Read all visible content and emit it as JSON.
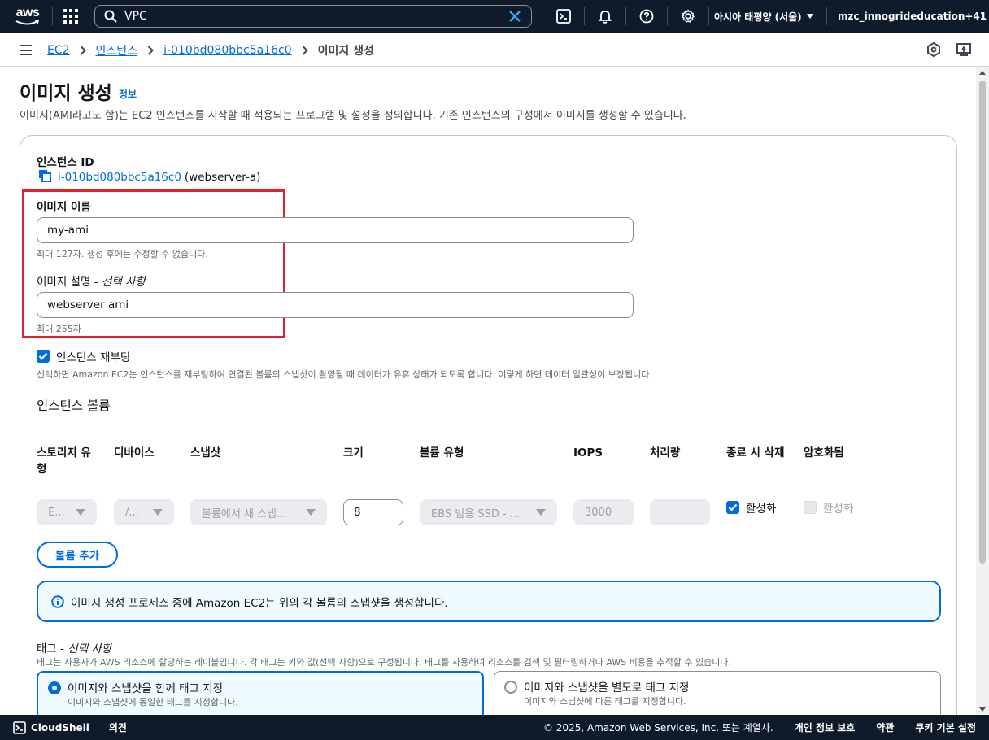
{
  "topnav": {
    "logo_text": "aws",
    "search_value": "VPC",
    "region": "아시아 태평양 (서울)",
    "account": "mzc_innogrideducation+41"
  },
  "breadcrumb": {
    "items": [
      "EC2",
      "인스턴스",
      "i-010bd080bbc5a16c0"
    ],
    "current": "이미지 생성"
  },
  "page": {
    "title": "이미지 생성",
    "info_link": "정보",
    "description": "이미지(AMI라고도 함)는 EC2 인스턴스를 시작할 때 적용되는 프로그램 및 설정을 정의합니다. 기존 인스턴스의 구성에서 이미지를 생성할 수 있습니다."
  },
  "form": {
    "instance_id_label": "인스턴스 ID",
    "instance_id": "i-010bd080bbc5a16c0",
    "instance_name": "(webserver-a)",
    "image_name_label": "이미지 이름",
    "image_name_value": "my-ami",
    "image_name_hint": "최대 127자. 생성 후에는 수정할 수 없습니다.",
    "image_desc_label": "이미지 설명 - ",
    "image_desc_optional": "선택 사항",
    "image_desc_value": "webserver ami",
    "image_desc_hint": "최대 255자",
    "reboot_label": "인스턴스 재부팅",
    "reboot_checked": true,
    "reboot_desc": "선택하면 Amazon EC2는 인스턴스를 재부팅하여 연결된 볼륨의 스냅샷이 촬영될 때 데이터가 유휴 상태가 되도록 합니다. 이렇게 하면 데이터 일관성이 보장됩니다."
  },
  "volumes": {
    "heading": "인스턴스 볼륨",
    "columns": [
      "스토리지 유형",
      "디바이스",
      "스냅샷",
      "크기",
      "볼륨 유형",
      "IOPS",
      "처리량",
      "종료 시 삭제",
      "암호화됨"
    ],
    "columns_line1": [
      "스토리지 유",
      "디바이스",
      "스냅샷",
      "크기",
      "볼륨 유형",
      "IOPS",
      "처리량",
      "종료 시 삭제",
      "암호화됨"
    ],
    "columns_line2": [
      "형",
      "",
      "",
      "",
      "",
      "",
      "",
      "",
      ""
    ],
    "row": {
      "storage_type": "E...",
      "device": "/...",
      "snapshot": "볼륨에서 새 스냅...",
      "size": "8",
      "volume_type": "EBS 범용 SSD - ...",
      "iops": "3000",
      "throughput": "",
      "delete_on_termination": "활성화",
      "encrypted": "활성화"
    },
    "add_button": "볼륨 추가"
  },
  "alert": {
    "text": "이미지 생성 프로세스 중에 Amazon EC2는 위의 각 볼륨의 스냅샷을 생성합니다."
  },
  "tags": {
    "label": "태그 - ",
    "optional": "선택 사항",
    "description": "태그는 사용자가 AWS 리소스에 할당하는 레이블입니다. 각 태그는 키와 값(선택 사항)으로 구성됩니다. 태그를 사용하여 리소스를 검색 및 필터링하거나 AWS 비용을 추적할 수 있습니다.",
    "options": [
      {
        "title": "이미지와 스냅샷을 함께 태그 지정",
        "desc": "이미지와 스냅샷에 동일한 태그를 지정합니다.",
        "selected": true
      },
      {
        "title": "이미지와 스냅샷을 별도로 태그 지정",
        "desc": "이미지와 스냅샷에 다른 태그를 지정합니다.",
        "selected": false
      }
    ]
  },
  "footer": {
    "cloudshell": "CloudShell",
    "feedback": "의견",
    "copyright": "© 2025, Amazon Web Services, Inc. 또는 계열사.",
    "privacy": "개인 정보 보호",
    "terms": "약관",
    "cookies": "쿠키 기본 설정"
  },
  "colors": {
    "nav_bg": "#0f1b2a",
    "link": "#006ce0",
    "highlight_box": "#e0212f",
    "alert_bg": "#f0fbff"
  }
}
